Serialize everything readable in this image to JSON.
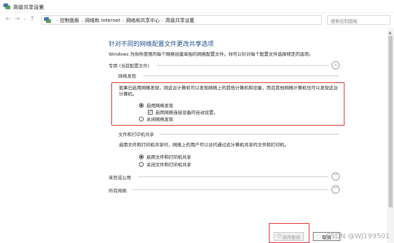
{
  "window": {
    "title": "高级共享设置",
    "icon": "network-icon"
  },
  "nav": {
    "back_icon": "arrow-left-icon",
    "forward_icon": "arrow-right-icon",
    "recent_icon": "chevron-down-icon",
    "up_icon": "arrow-up-icon"
  },
  "address": {
    "crumbs": [
      "控制面板",
      "网络和 Internet",
      "网络和共享中心",
      "高级共享设置"
    ],
    "separator": "›",
    "dropdown_glyph": "⌄",
    "refresh_glyph": "↻"
  },
  "search": {
    "placeholder": "搜索控制面板"
  },
  "main": {
    "heading": "针对不同的网络配置文件更改共享选项",
    "description": "Windows 为你所使用的每个网络创建单独的网络配置文件。你可以针对每个配置文件选择特定的选项。"
  },
  "private": {
    "label": "专用 (当前配置文件)",
    "toggle_glyph": "︿",
    "discovery": {
      "header": "网络发现",
      "paragraph": "如果已启用网络发现，则这台计算机可以发现网络上的其他计算机和设备，而且其他网络计算机也可以发现这台计算机。",
      "enable_label": "启用网络发现",
      "auto_setup_label": "启用网络连接设备的自动设置。",
      "disable_label": "关闭网络发现",
      "enabled": true,
      "auto_setup_checked": true
    },
    "file_sharing": {
      "header": "文件和打印机共享",
      "paragraph": "启用文件和打印机共享时，网络上的用户可以访问通过此计算机共享的文件和打印机。",
      "enable_label": "启用文件和打印机共享",
      "disable_label": "关闭文件和打印机共享",
      "enabled": true
    }
  },
  "guest": {
    "label": "来宾或公用",
    "toggle_glyph": "﹀"
  },
  "all_networks": {
    "label": "所有网络",
    "toggle_glyph": "﹀"
  },
  "buttons": {
    "save": "保存更改",
    "cancel": "取消"
  },
  "watermark": "CSDN @WJ199501",
  "colors": {
    "heading": "#1e4e8c",
    "highlight": "#e03030"
  }
}
